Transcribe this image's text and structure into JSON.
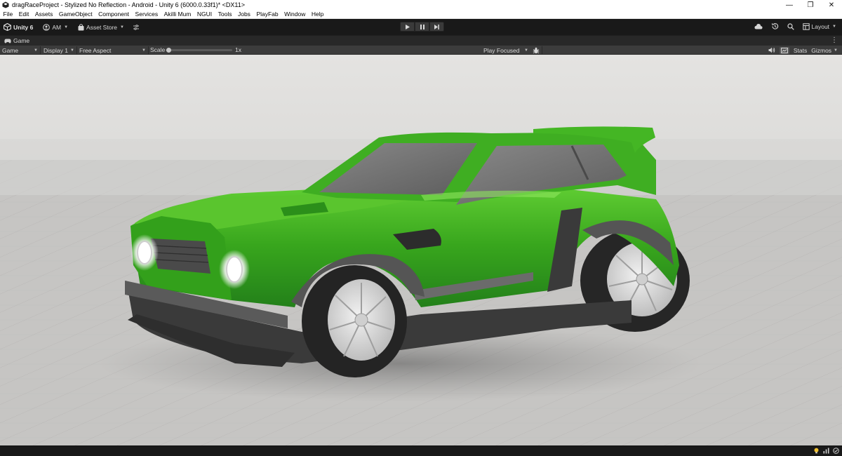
{
  "window": {
    "title": "dragRaceProject - Stylized No Reflection - Android - Unity 6 (6000.0.33f1)* <DX11>",
    "controls": {
      "minimize": "—",
      "restore": "❐",
      "close": "✕"
    }
  },
  "menu": {
    "items": [
      "File",
      "Edit",
      "Assets",
      "GameObject",
      "Component",
      "Services",
      "Akilli Mum",
      "NGUI",
      "Tools",
      "Jobs",
      "PlayFab",
      "Window",
      "Help"
    ]
  },
  "toolbar": {
    "unity_label": "Unity 6",
    "account_label": "AM",
    "asset_store_label": "Asset Store",
    "layout_label": "Layout",
    "icons": [
      "unity-logo-icon",
      "account-icon",
      "asset-store-icon",
      "scale-icon",
      "play-icon",
      "pause-icon",
      "step-icon",
      "cloud-icon",
      "history-icon",
      "search-icon"
    ]
  },
  "tab": {
    "label": "Game"
  },
  "gameview": {
    "view_type": "Game",
    "display": "Display 1",
    "aspect": "Free Aspect",
    "scale_label": "Scale",
    "scale_value": "1x",
    "play_mode": "Play Focused",
    "stats_label": "Stats",
    "gizmos_label": "Gizmos"
  },
  "colors": {
    "car_body": "#3aa81e",
    "car_body_light": "#6ad63a",
    "car_body_dark": "#1f6e12",
    "window_glass": "#6e6e6e",
    "floor": "#c3c3c3",
    "toolbar_bg": "#191919",
    "gamebar_bg": "#3c3c3c"
  }
}
